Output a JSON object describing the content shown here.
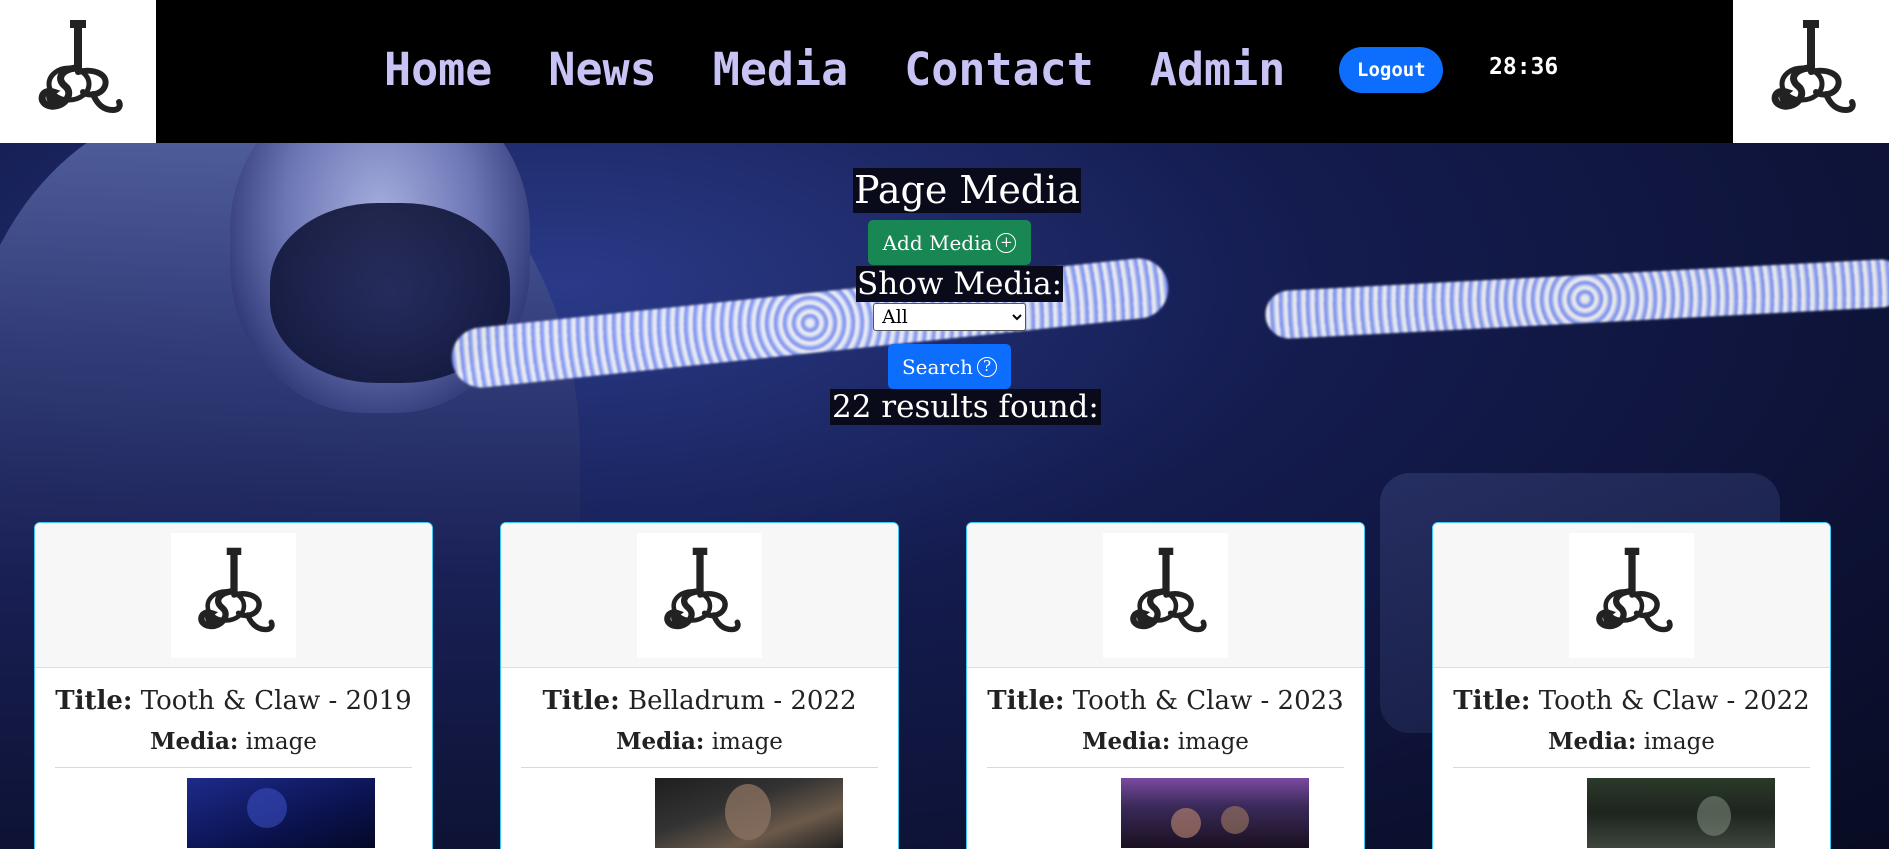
{
  "header": {
    "nav": [
      "Home",
      "News",
      "Media",
      "Contact",
      "Admin"
    ],
    "logout_label": "Logout",
    "timer": "28:36",
    "logo_name": "sr-guitar-logo"
  },
  "main": {
    "page_title": "Page Media",
    "add_media_label": "Add Media",
    "show_media_label": "Show Media:",
    "show_media_select": {
      "selected": "All"
    },
    "search_label": "Search",
    "results_text": "22 results found:"
  },
  "cards": [
    {
      "title_label": "Title:",
      "title": "Tooth & Claw - 2019",
      "media_label": "Media:",
      "media": "image"
    },
    {
      "title_label": "Title:",
      "title": "Belladrum - 2022",
      "media_label": "Media:",
      "media": "image"
    },
    {
      "title_label": "Title:",
      "title": "Tooth & Claw - 2023",
      "media_label": "Media:",
      "media": "image"
    },
    {
      "title_label": "Title:",
      "title": "Tooth & Claw - 2022",
      "media_label": "Media:",
      "media": "image"
    }
  ],
  "colors": {
    "header_bg": "#000000",
    "nav_text": "#c8c3f5",
    "logout_bg": "#0d6efd",
    "add_media_bg": "#198754",
    "search_bg": "#0d6efd",
    "card_border": "#3fc8f2"
  }
}
